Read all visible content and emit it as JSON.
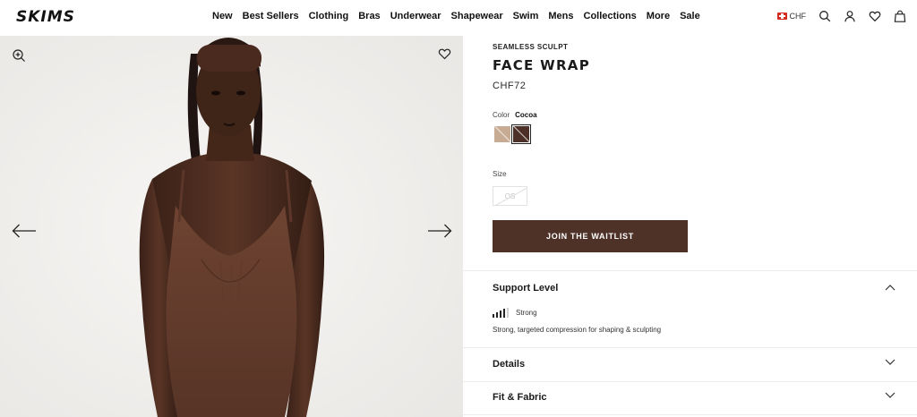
{
  "header": {
    "logo": "SKIMS",
    "nav": [
      "New",
      "Best Sellers",
      "Clothing",
      "Bras",
      "Underwear",
      "Shapewear",
      "Swim",
      "Mens",
      "Collections",
      "More",
      "Sale"
    ],
    "currency": "CHF",
    "icons": [
      "search-icon",
      "account-icon",
      "wishlist-heart-icon",
      "shopping-bag-icon"
    ]
  },
  "gallery": {
    "icons": [
      "zoom-in-icon",
      "favorite-heart-icon",
      "arrow-left-icon",
      "arrow-right-icon"
    ]
  },
  "product": {
    "collection": "SEAMLESS SCULPT",
    "title": "FACE WRAP",
    "price": "CHF72",
    "color_label": "Color",
    "color_value": "Cocoa",
    "swatches": [
      {
        "color": "#c7ab93",
        "selected": false
      },
      {
        "color": "#4d3128",
        "selected": true
      }
    ],
    "size_label": "Size",
    "sizes": [
      {
        "label": "OS",
        "available": false
      }
    ],
    "cta": "JOIN THE WAITLIST",
    "cta_color": "#4e3127"
  },
  "accordion": {
    "support": {
      "title": "Support Level",
      "expanded": true,
      "level": "Strong",
      "bars_filled": 4,
      "bars_total": 5,
      "description": "Strong, targeted compression for shaping & sculpting"
    },
    "details": {
      "title": "Details",
      "expanded": false
    },
    "fit": {
      "title": "Fit & Fabric",
      "expanded": false
    }
  }
}
